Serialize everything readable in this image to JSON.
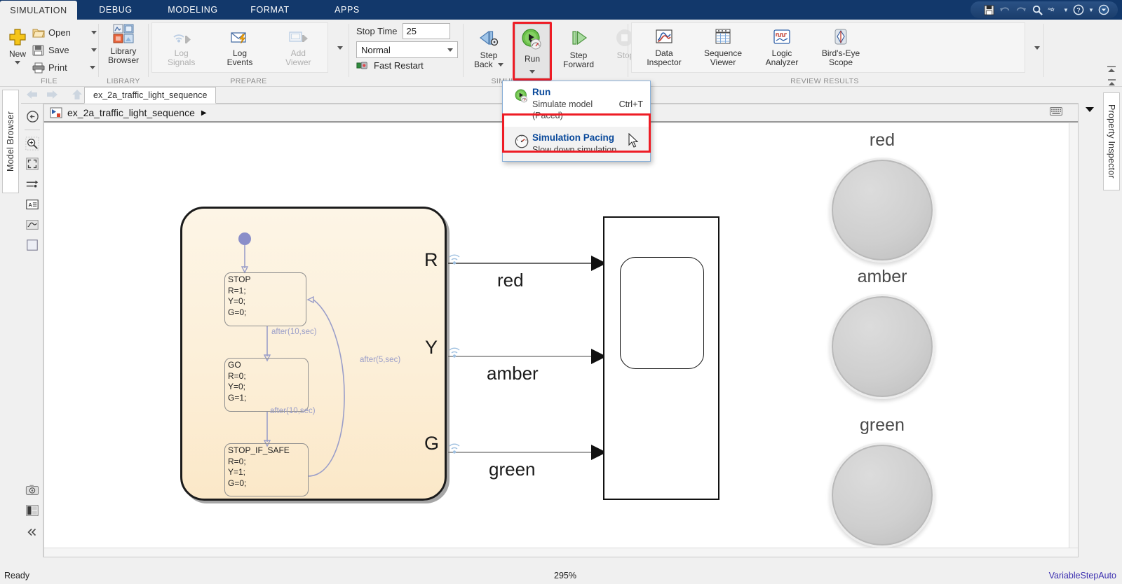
{
  "menu": {
    "tabs": [
      {
        "label": "SIMULATION",
        "active": true
      },
      {
        "label": "DEBUG",
        "active": false
      },
      {
        "label": "MODELING",
        "active": false
      },
      {
        "label": "FORMAT",
        "active": false
      },
      {
        "label": "APPS",
        "active": false
      }
    ],
    "quick_access": [
      "save-icon",
      "undo-icon",
      "redo-icon",
      "search-icon",
      "shortcuts-icon",
      "caret-down-icon",
      "help-icon",
      "caret-down-icon",
      "collapse-icon"
    ]
  },
  "ribbon": {
    "groups": [
      {
        "name": "FILE",
        "label": "FILE"
      },
      {
        "name": "LIBRARY",
        "label": "LIBRARY"
      },
      {
        "name": "PREPARE",
        "label": "PREPARE"
      },
      {
        "name": "SIMULATE",
        "label": "SIMULATE"
      },
      {
        "name": "REVIEW RESULTS",
        "label": "REVIEW RESULTS"
      }
    ],
    "file": {
      "new_label": "New",
      "open_label": "Open",
      "save_label": "Save",
      "print_label": "Print"
    },
    "library": {
      "line1": "Library",
      "line2": "Browser"
    },
    "prepare": {
      "log_signals_l1": "Log",
      "log_signals_l2": "Signals",
      "log_events_l1": "Log",
      "log_events_l2": "Events",
      "add_viewer_l1": "Add",
      "add_viewer_l2": "Viewer"
    },
    "simulate": {
      "stop_time_label": "Stop Time",
      "stop_time_value": "25",
      "mode_value": "Normal",
      "fast_restart_label": "Fast Restart",
      "step_back_l1": "Step",
      "step_back_l2": "Back",
      "run_label": "Run",
      "step_fwd_l1": "Step",
      "step_fwd_l2": "Forward",
      "stop_label": "Stop"
    },
    "review": {
      "data_inspector_l1": "Data",
      "data_inspector_l2": "Inspector",
      "sequence_viewer_l1": "Sequence",
      "sequence_viewer_l2": "Viewer",
      "logic_analyzer_l1": "Logic",
      "logic_analyzer_l2": "Analyzer",
      "birdseye_l1": "Bird's-Eye",
      "birdseye_l2": "Scope"
    }
  },
  "run_dropdown": {
    "items": [
      {
        "title": "Run",
        "subtitle": "Simulate model (Paced)",
        "shortcut": "Ctrl+T",
        "icon": "run-paced-icon",
        "selected": false
      },
      {
        "title": "Simulation Pacing",
        "subtitle": "Slow down simulation",
        "shortcut": "",
        "icon": "gauge-icon",
        "selected": true
      }
    ]
  },
  "panels": {
    "model_browser_label": "Model Browser",
    "property_inspector_label": "Property Inspector"
  },
  "tabs": {
    "file_tab_label": "ex_2a_traffic_light_sequence"
  },
  "breadcrumb": {
    "model_name": "ex_2a_traffic_light_sequence"
  },
  "canvas": {
    "chart": {
      "states": [
        {
          "name": "STOP",
          "lines": [
            "R=1;",
            "Y=0;",
            "G=0;"
          ]
        },
        {
          "name": "GO",
          "lines": [
            "R=0;",
            "Y=0;",
            "G=1;"
          ]
        },
        {
          "name": "STOP_IF_SAFE",
          "lines": [
            "R=0;",
            "Y=1;",
            "G=0;"
          ]
        }
      ],
      "transitions": [
        {
          "label": "after(10,sec)"
        },
        {
          "label": "after(10,sec)"
        },
        {
          "label": "after(5,sec)"
        }
      ],
      "outports": [
        "R",
        "Y",
        "G"
      ]
    },
    "signals": [
      "red",
      "amber",
      "green"
    ],
    "lamps": [
      {
        "label": "red"
      },
      {
        "label": "amber"
      },
      {
        "label": "green"
      }
    ]
  },
  "status": {
    "left": "Ready",
    "zoom": "295%",
    "right": "VariableStepAuto"
  },
  "colors": {
    "menu_blue": "#12386b",
    "highlight_red": "#ee1c25",
    "link_blue": "#0b4a9b",
    "chart_fill": "#fdf2dd",
    "status_right": "#3b2fb0"
  }
}
